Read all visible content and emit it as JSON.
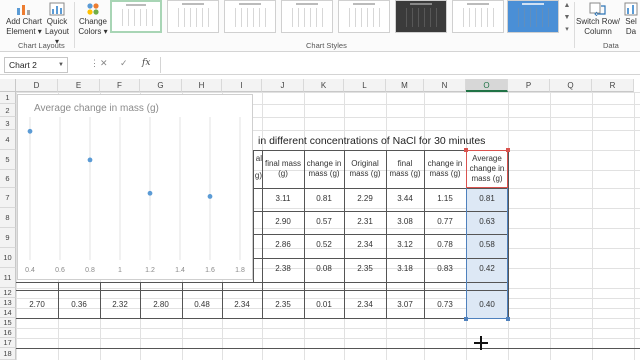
{
  "ribbon": {
    "add_chart_element": [
      "Add Chart",
      "Element ▾"
    ],
    "quick_layout": [
      "Quick",
      "Layout ▾"
    ],
    "change_colors": [
      "Change",
      "Colors ▾"
    ],
    "switch_row_column": [
      "Switch Row/",
      "Column"
    ],
    "select_data": [
      "Sel",
      "Da"
    ],
    "group_chart_layouts": "Chart Layouts",
    "group_chart_styles": "Chart Styles",
    "group_data": "Data"
  },
  "formula_bar": {
    "name_box": "Chart 2",
    "fx": "fx"
  },
  "columns": [
    "D",
    "E",
    "F",
    "G",
    "H",
    "I",
    "J",
    "K",
    "L",
    "M",
    "N",
    "O",
    "P",
    "Q",
    "R"
  ],
  "rows": [
    "1",
    "2",
    "3",
    "4",
    "5",
    "6",
    "7",
    "8",
    "9",
    "10",
    "11",
    "12",
    "13",
    "14",
    "15",
    "16",
    "17",
    "18"
  ],
  "sheet": {
    "title": "in different concentrations of NaCl for 30 minutes",
    "header_fragments": {
      "i_top": "al",
      "i_bottom": "g)"
    },
    "headers": {
      "J": "final mass (g)",
      "K": "change in mass (g)",
      "L": "Original mass (g)",
      "M": "final mass (g)",
      "N": "change in mass (g)",
      "O": "Average change in mass (g)"
    },
    "rows": [
      {
        "J": "3.11",
        "K": "0.81",
        "L": "2.29",
        "M": "3.44",
        "N": "1.15",
        "O": "0.81"
      },
      {
        "J": "2.90",
        "K": "0.57",
        "L": "2.31",
        "M": "3.08",
        "N": "0.77",
        "O": "0.63"
      },
      {
        "J": "2.86",
        "K": "0.52",
        "L": "2.34",
        "M": "3.12",
        "N": "0.78",
        "O": "0.58"
      },
      {
        "J": "2.38",
        "K": "0.08",
        "L": "2.35",
        "M": "3.18",
        "N": "0.83",
        "O": "0.42"
      }
    ],
    "last_row": {
      "D": "2.70",
      "E": "0.36",
      "F": "2.32",
      "G": "2.80",
      "H": "0.48",
      "I": "2.34",
      "J": "2.35",
      "K": "0.01",
      "L": "2.34",
      "M": "3.07",
      "N": "0.73",
      "O": "0.40"
    }
  },
  "chart_data": {
    "type": "scatter",
    "title": "Average change in mass (g)",
    "x": [
      0.4,
      0.8,
      1.2,
      1.6
    ],
    "y": [
      0.81,
      0.63,
      0.42,
      0.4
    ],
    "xlim": [
      0.4,
      1.8
    ],
    "x_ticks": [
      "0.4",
      "0.6",
      "0.8",
      "1",
      "1.2",
      "1.4",
      "1.6",
      "1.8"
    ],
    "ylim": [
      0,
      0.9
    ],
    "grid": "vertical",
    "marker_color": "#5b9bd5"
  }
}
